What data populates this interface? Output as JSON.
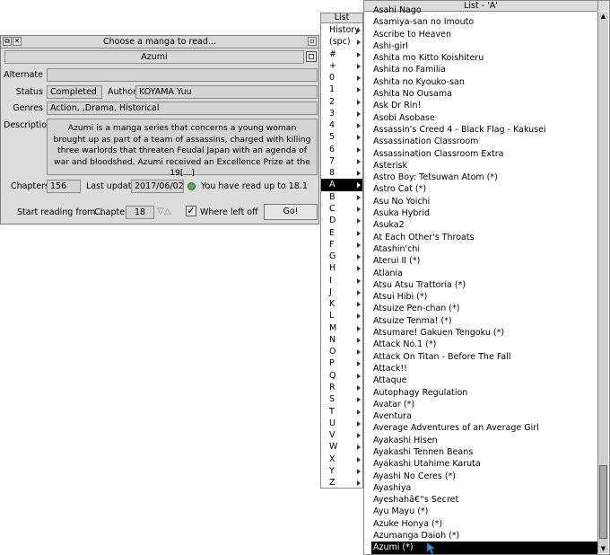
{
  "dialog": {
    "title": "Choose a manga to read...",
    "manga_name": "Azumi",
    "alternate_label": "Alternate",
    "alternate_value": "",
    "status_label": "Status",
    "status_value": "Completed",
    "author_label": "Author",
    "author_value": "KOYAMA Yuu",
    "genres_label": "Genres",
    "genres_value": "Action, ,Drama, Historical",
    "description_label": "Description",
    "description_value": "Azumi is a manga series that concerns a young woman brought up as part of a team of assassins, charged with killing three warlords that threaten Feudal Japan with an agenda of war and bloodshed.  Azumi received an Excellence Prize at the 19[...]",
    "chapters_label": "Chapters",
    "chapters_value": "156",
    "last_update_label": "Last update",
    "last_update_value": "2017/06/02",
    "read_status": "You have read up to 18.1",
    "start_label": "Start reading from...",
    "chapter_label": "Chapter",
    "chapter_value": "18",
    "where_left_label": "Where left off",
    "where_left_checked": true,
    "go_label": "Go!"
  },
  "menu": {
    "title": "List",
    "items": [
      "History",
      "(spc)",
      "#",
      "+",
      "0",
      "1",
      "2",
      "3",
      "4",
      "5",
      "6",
      "7",
      "8",
      "A",
      "B",
      "C",
      "D",
      "E",
      "F",
      "G",
      "H",
      "I",
      "J",
      "K",
      "L",
      "M",
      "N",
      "O",
      "P",
      "Q",
      "R",
      "S",
      "T",
      "U",
      "V",
      "W",
      "X",
      "Y",
      "Z"
    ],
    "selected_index": 13
  },
  "list": {
    "title": "List - 'A'",
    "items": [
      "Asahi Nago",
      "Asamiya-san no Imouto",
      "Ascribe to Heaven",
      "Ashi-girl",
      "Ashita mo Kitto Koishiteru",
      "Ashita no Familia",
      "Ashita no Kyouko-san",
      "Ashita No Ousama",
      "Ask Dr Rin!",
      "Asobi Asobase",
      "Assassin's Creed 4 - Black Flag - Kakusei",
      "Assassination Classroom",
      "Assassination Classroom Extra",
      "Asterisk",
      "Astro Boy: Tetsuwan Atom (*)",
      "Astro Cat (*)",
      "Asu No Yoichi",
      "Asuka Hybrid",
      "Asuka2",
      "At Each Other's Throats",
      "Atashin'chi",
      "Aterui II (*)",
      "Atlania",
      "Atsu Atsu Trattoria (*)",
      "Atsui Hibi (*)",
      "Atsuize Pen-chan (*)",
      "Atsuize Tenma! (*)",
      "Atsumare! Gakuen Tengoku (*)",
      "Attack No.1 (*)",
      "Attack On Titan - Before The Fall",
      "Attack!!",
      "Attaque",
      "Autophagy Regulation",
      "Avatar (*)",
      "Aventura",
      "Average Adventures of an Average Girl",
      "Ayakashi Hisen",
      "Ayakashi Tennen Beans",
      "Ayakashi Utahime Karuta",
      "Ayashi No Ceres (*)",
      "Ayashiya",
      "Ayeshahâ€“s Secret",
      "Ayu Mayu (*)",
      "Azuke Honya (*)",
      "Azumanga Daioh (*)",
      "Azumi (*)"
    ],
    "selected_index": 45
  },
  "colors": {
    "window_bg": "#dcdcdc",
    "field_bg": "#d4d4d4",
    "selection_bg": "#000000",
    "indicator_green": "#4caf50"
  }
}
